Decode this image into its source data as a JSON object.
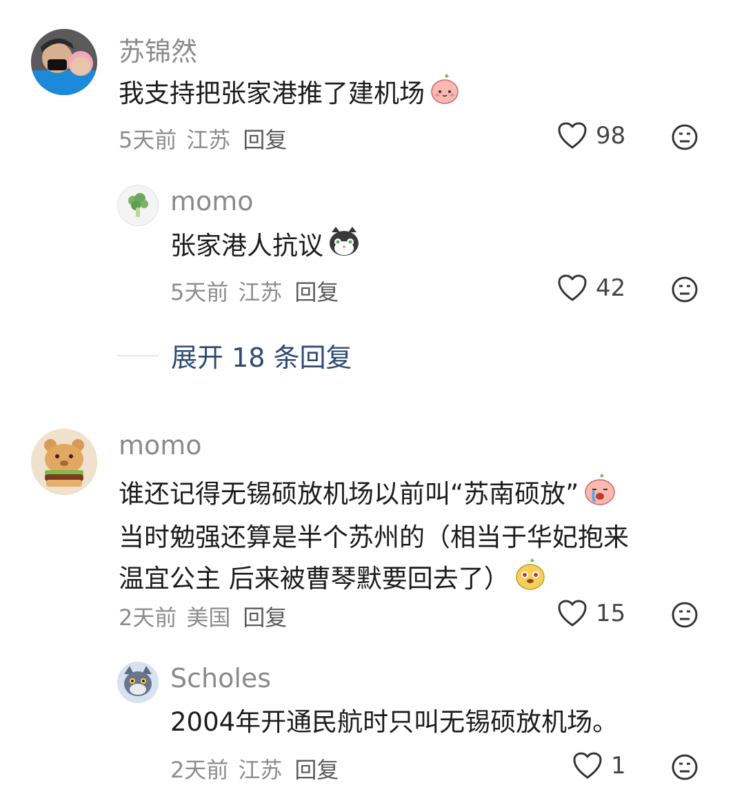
{
  "comments": [
    {
      "username": "苏锦然",
      "text": "我支持把张家港推了建机场",
      "time": "5天前",
      "location": "江苏",
      "reply_label": "回复",
      "likes": "98",
      "avatar": "photo-avatar",
      "emoji": "peach-face-emoji",
      "replies": [
        {
          "username": "momo",
          "text": "张家港人抗议",
          "time": "5天前",
          "location": "江苏",
          "reply_label": "回复",
          "likes": "42",
          "avatar": "broccoli-avatar",
          "emoji": "cat-face-emoji"
        }
      ],
      "expand_label": "展开 18 条回复"
    },
    {
      "username": "momo",
      "text_lines": [
        "谁还记得无锡硕放机场以前叫“苏南硕放”",
        "当时勉强还算是半个苏州的（相当于华妃抱来",
        "温宜公主 后来被曹琴默要回去了）"
      ],
      "time": "2天前",
      "location": "美国",
      "reply_label": "回复",
      "likes": "15",
      "avatar": "bear-burger-avatar",
      "emoji": "crying-peach-emoji",
      "emoji2": "dog-face-emoji",
      "replies": [
        {
          "username": "Scholes",
          "text": "2004年开通民航时只叫无锡硕放机场。",
          "time": "2天前",
          "location": "江苏",
          "reply_label": "回复",
          "likes": "1",
          "avatar": "cartoon-cat-avatar"
        }
      ]
    }
  ],
  "colors": {
    "username": "#8a8a8a",
    "text": "#1c1c1c",
    "meta": "#8c8c8c",
    "expand": "#2e4a72"
  }
}
